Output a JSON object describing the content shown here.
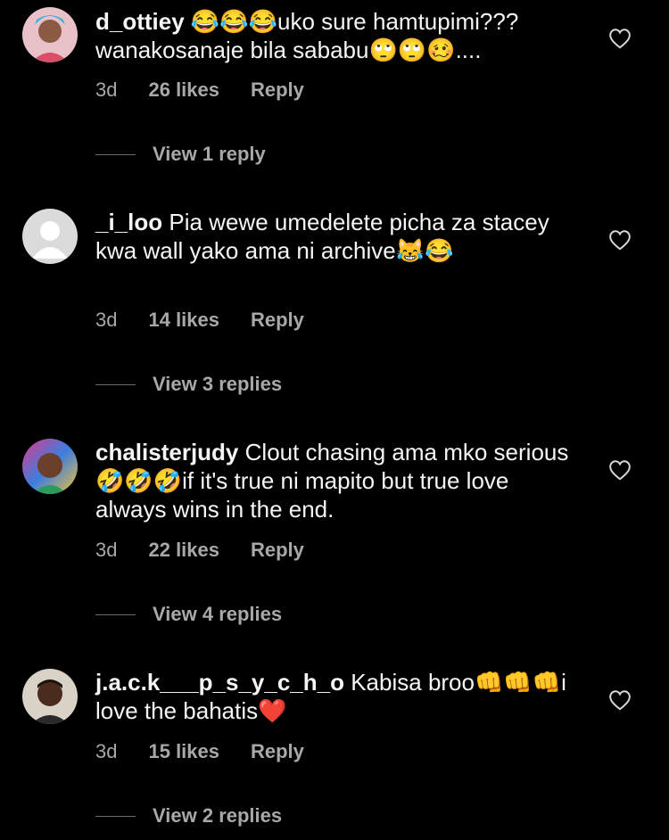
{
  "comments": [
    {
      "username": "d_ottiey",
      "text": "😂😂😂uko sure hamtupimi??? wanakosanaje bila sababu🙄🙄🥴....",
      "time": "3d",
      "likes": "26 likes",
      "reply_label": "Reply",
      "view_replies": "View 1 reply"
    },
    {
      "username": "_i_loo",
      "text": "Pia wewe umedelete picha za stacey kwa wall yako ama ni archive😹😂",
      "time": "3d",
      "likes": "14 likes",
      "reply_label": "Reply",
      "view_replies": "View 3 replies"
    },
    {
      "username": "chalisterjudy",
      "text": "Clout chasing ama mko serious 🤣🤣🤣if it's true ni mapito but true love always wins in the end.",
      "time": "3d",
      "likes": "22 likes",
      "reply_label": "Reply",
      "view_replies": "View 4 replies"
    },
    {
      "username": "j.a.c.k___p_s_y_c_h_o",
      "text": "Kabisa broo👊👊👊i love the bahatis❤️",
      "time": "3d",
      "likes": "15 likes",
      "reply_label": "Reply",
      "view_replies": "View 2 replies"
    }
  ],
  "icons": {
    "like": "heart-outline-icon"
  }
}
